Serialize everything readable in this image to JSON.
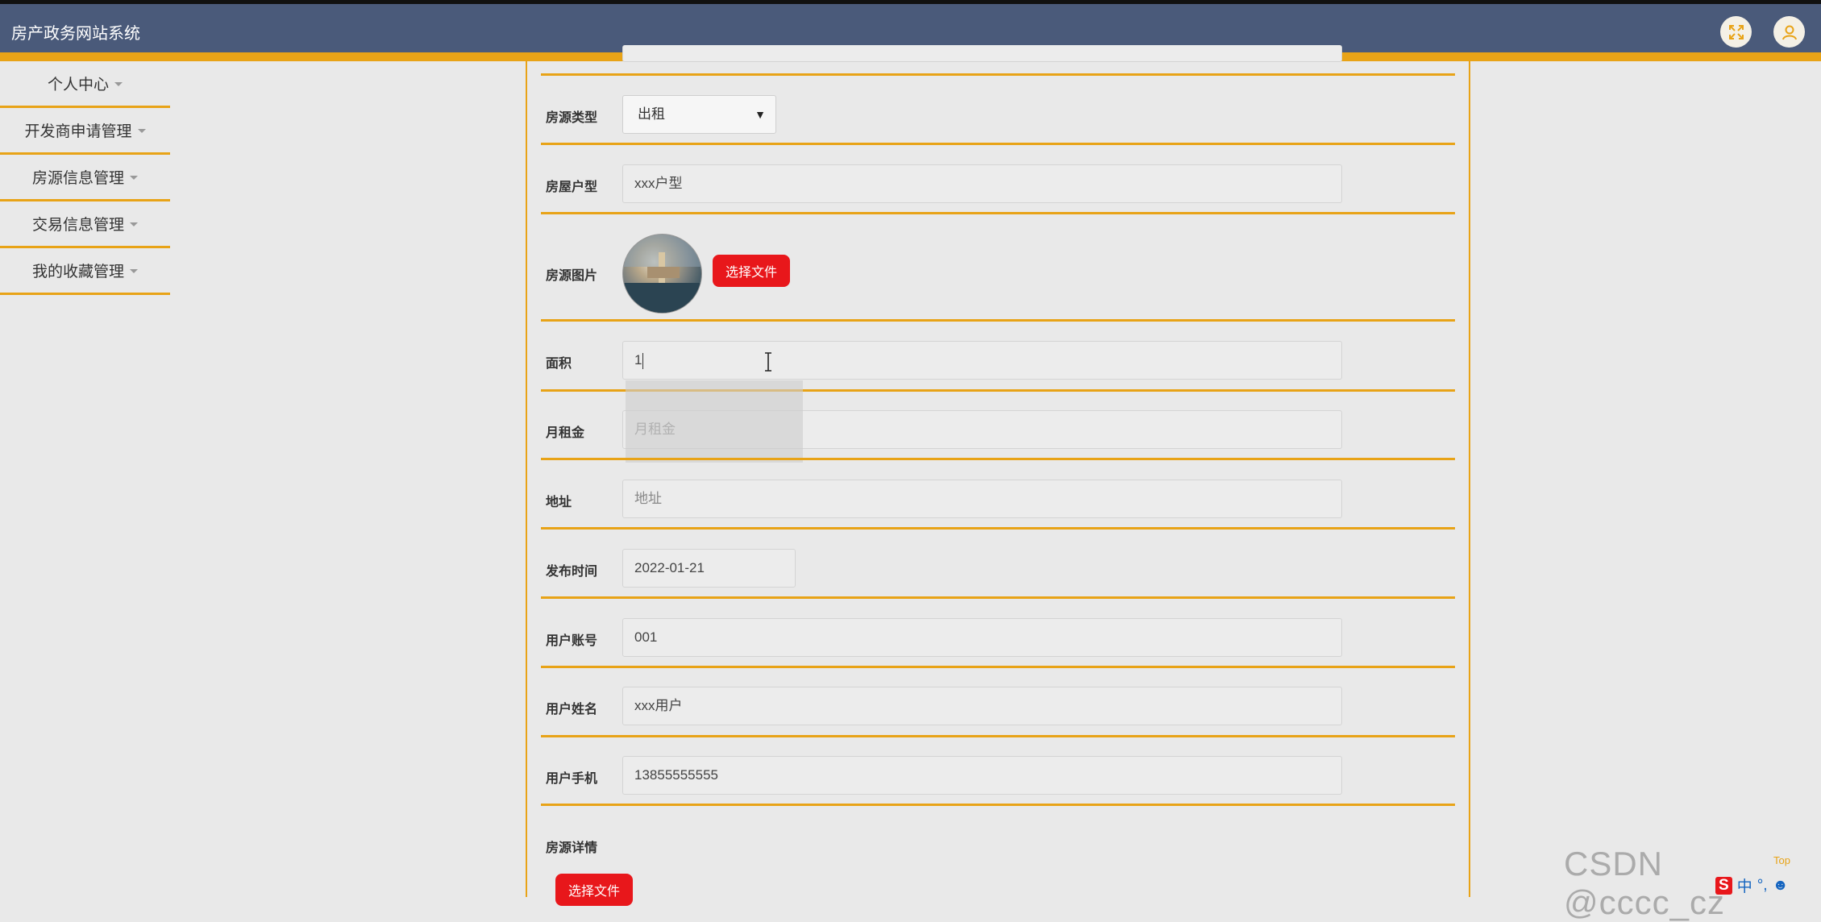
{
  "app": {
    "title": "房产政务网站系统"
  },
  "header": {
    "icons": [
      "fullscreen-icon",
      "user-icon"
    ]
  },
  "sidebar": {
    "items": [
      {
        "label": "个人中心"
      },
      {
        "label": "开发商申请管理"
      },
      {
        "label": "房源信息管理"
      },
      {
        "label": "交易信息管理"
      },
      {
        "label": "我的收藏管理"
      }
    ]
  },
  "form": {
    "house_type": {
      "label": "房源类型",
      "value": "出租"
    },
    "layout": {
      "label": "房屋户型",
      "value": "xxx户型"
    },
    "image": {
      "label": "房源图片",
      "button": "选择文件"
    },
    "area": {
      "label": "面积",
      "value": "1"
    },
    "rent": {
      "label": "月租金",
      "placeholder": "月租金"
    },
    "address": {
      "label": "地址",
      "placeholder": "地址"
    },
    "publish_time": {
      "label": "发布时间",
      "value": "2022-01-21"
    },
    "account": {
      "label": "用户账号",
      "value": "001"
    },
    "username": {
      "label": "用户姓名",
      "value": "xxx用户"
    },
    "phone": {
      "label": "用户手机",
      "value": "13855555555"
    },
    "details": {
      "label": "房源详情",
      "button": "选择文件"
    }
  },
  "overlay": {
    "watermark": "CSDN @cccc_cz",
    "top_link": "Top",
    "tray_text": "中"
  },
  "colors": {
    "accent": "#e8a317",
    "header": "#4a5a7a",
    "button": "#e8171b"
  }
}
